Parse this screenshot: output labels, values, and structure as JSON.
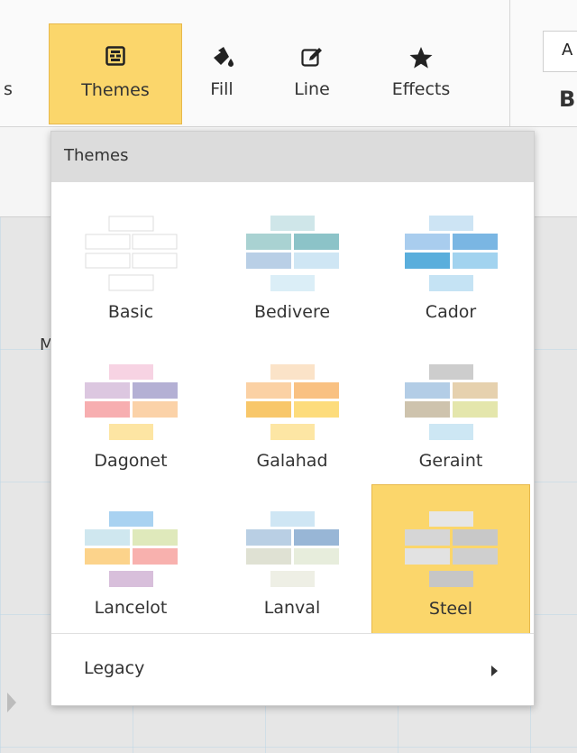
{
  "toolbar": {
    "partial_label": "s",
    "tools": [
      {
        "label": "Themes",
        "icon": "themes-icon",
        "active": true
      },
      {
        "label": "Fill",
        "icon": "fill-bucket-icon"
      },
      {
        "label": "Line",
        "icon": "edit-line-icon"
      },
      {
        "label": "Effects",
        "icon": "star-icon"
      }
    ],
    "font_box": "A",
    "bold_label": "B"
  },
  "canvas": {
    "partial_text": "M"
  },
  "themes_popup": {
    "header": "Themes",
    "themes": [
      {
        "name": "Basic"
      },
      {
        "name": "Bedivere"
      },
      {
        "name": "Cador"
      },
      {
        "name": "Dagonet"
      },
      {
        "name": "Galahad"
      },
      {
        "name": "Geraint"
      },
      {
        "name": "Lancelot"
      },
      {
        "name": "Lanval"
      },
      {
        "name": "Steel",
        "selected": true
      }
    ],
    "legacy_label": "Legacy"
  },
  "colors": {
    "accent": "#fbd66b",
    "accent_border": "#e8b84a"
  }
}
